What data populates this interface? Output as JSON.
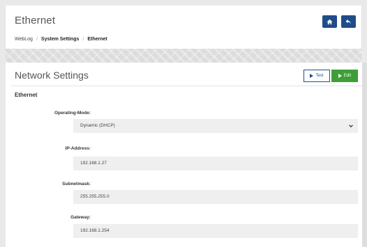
{
  "header": {
    "title": "Ethernet",
    "breadcrumb": [
      "WebLog",
      "System Settings",
      "Ethernet"
    ],
    "home_icon": "home-icon",
    "back_icon": "back-arrow-icon",
    "button_color": "#1e4d8a"
  },
  "panel": {
    "title": "Network Settings",
    "test_label": "Test",
    "edit_label": "Edit",
    "edit_color": "#3f9e38",
    "section_title": "Ethernet",
    "fields": [
      {
        "label": "Operating-Mode:",
        "value": "Dynamic (DHCP)",
        "type": "select"
      },
      {
        "label": "IP-Address:",
        "value": "192.168.1.27",
        "type": "text"
      },
      {
        "label": "Subnetmask:",
        "value": "255.255.255.0",
        "type": "text"
      },
      {
        "label": "Gateway:",
        "value": "192.168.1.254",
        "type": "text"
      }
    ]
  }
}
